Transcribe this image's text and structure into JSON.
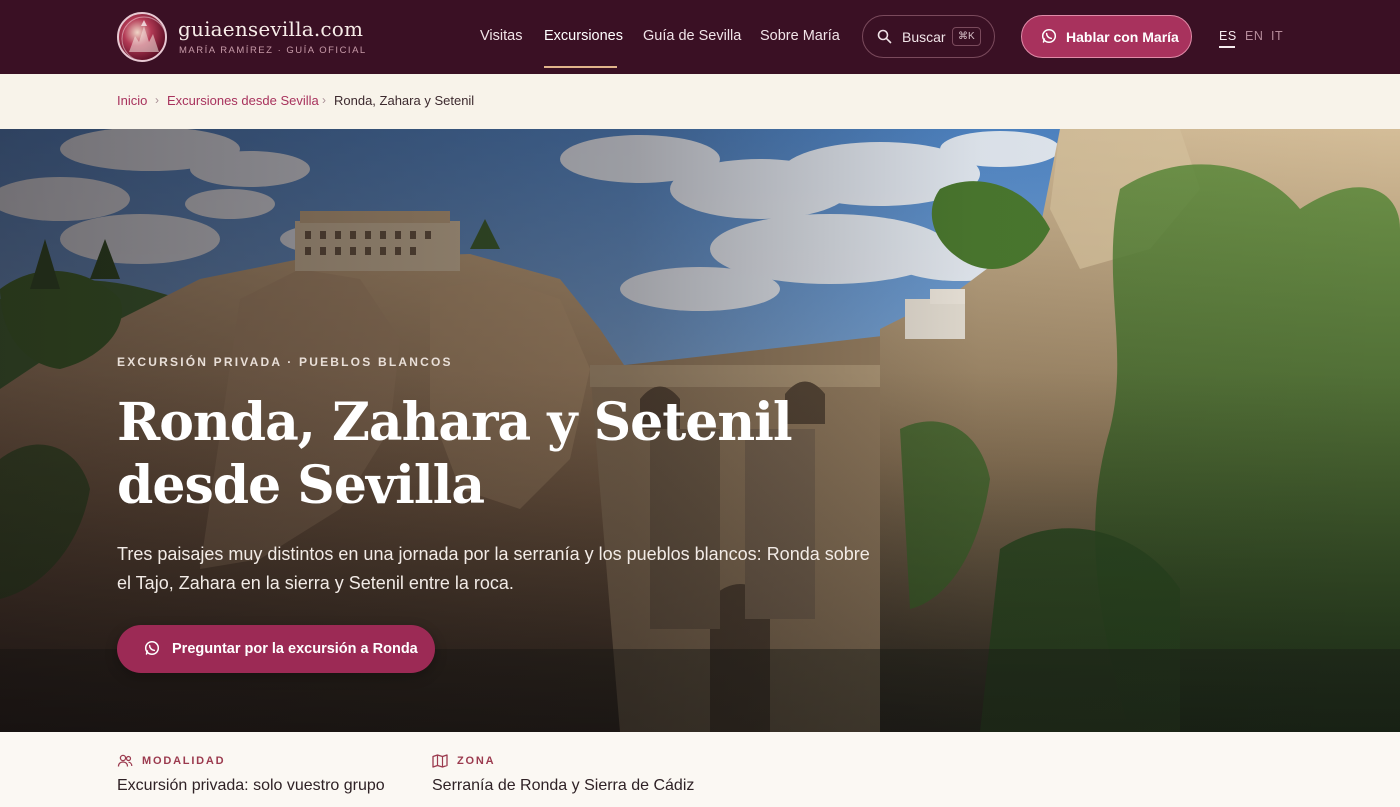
{
  "header": {
    "brand": "guiaensevilla.com",
    "brand_sub": "MARÍA RAMÍREZ · GUÍA OFICIAL",
    "nav": [
      {
        "label": "Visitas"
      },
      {
        "label": "Excursiones",
        "active": true
      },
      {
        "label": "Guía de Sevilla"
      },
      {
        "label": "Sobre María"
      }
    ],
    "search": {
      "label": "Buscar",
      "shortcut": "⌘K"
    },
    "cta_label": "Hablar con María",
    "languages": [
      {
        "code": "ES",
        "active": true
      },
      {
        "code": "EN"
      },
      {
        "code": "IT"
      }
    ]
  },
  "breadcrumb": {
    "items": [
      "Inicio",
      "Excursiones desde Sevilla",
      "Ronda, Zahara y Setenil"
    ],
    "separator": "›"
  },
  "hero": {
    "eyebrow": "EXCURSIÓN PRIVADA · PUEBLOS BLANCOS",
    "title": "Ronda, Zahara y Setenil desde Sevilla",
    "description": "Tres paisajes muy distintos en una jornada por la serranía y los pueblos blancos: Ronda sobre el Tajo, Zahara en la sierra y Setenil entre la roca.",
    "button_label": "Preguntar por la excursión a Ronda"
  },
  "facts": [
    {
      "icon": "group-icon",
      "label": "MODALIDAD",
      "value": "Excursión privada: solo vuestro grupo"
    },
    {
      "icon": "map-icon",
      "label": "ZONA",
      "value": "Serranía de Ronda y Sierra de Cádiz"
    }
  ],
  "colors": {
    "header_bg": "#3a1024",
    "accent": "#a8325d",
    "accent_underline": "#e0b48a"
  }
}
